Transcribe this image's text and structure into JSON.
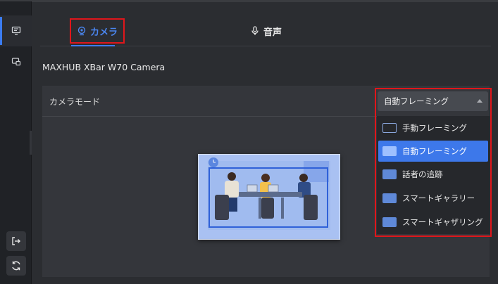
{
  "tabs": {
    "camera": "カメラ",
    "audio": "音声"
  },
  "device": {
    "name": "MAXHUB XBar W70 Camera"
  },
  "settings": {
    "camera_mode_label": "カメラモード",
    "camera_mode_value": "自動フレーミング"
  },
  "dropdown": {
    "options": [
      {
        "label": "手動フレーミング",
        "icon": "manual-framing-icon",
        "selected": false
      },
      {
        "label": "自動フレーミング",
        "icon": "auto-framing-icon",
        "selected": true
      },
      {
        "label": "話者の追跡",
        "icon": "speaker-tracking-icon",
        "selected": false
      },
      {
        "label": "スマートギャラリー",
        "icon": "smart-gallery-icon",
        "selected": false
      },
      {
        "label": "スマートギャザリング",
        "icon": "smart-gathering-icon",
        "selected": false
      }
    ]
  },
  "colors": {
    "accent": "#3b7cf2",
    "highlight_box": "#e0161b",
    "selected_item": "#3d78ea"
  }
}
